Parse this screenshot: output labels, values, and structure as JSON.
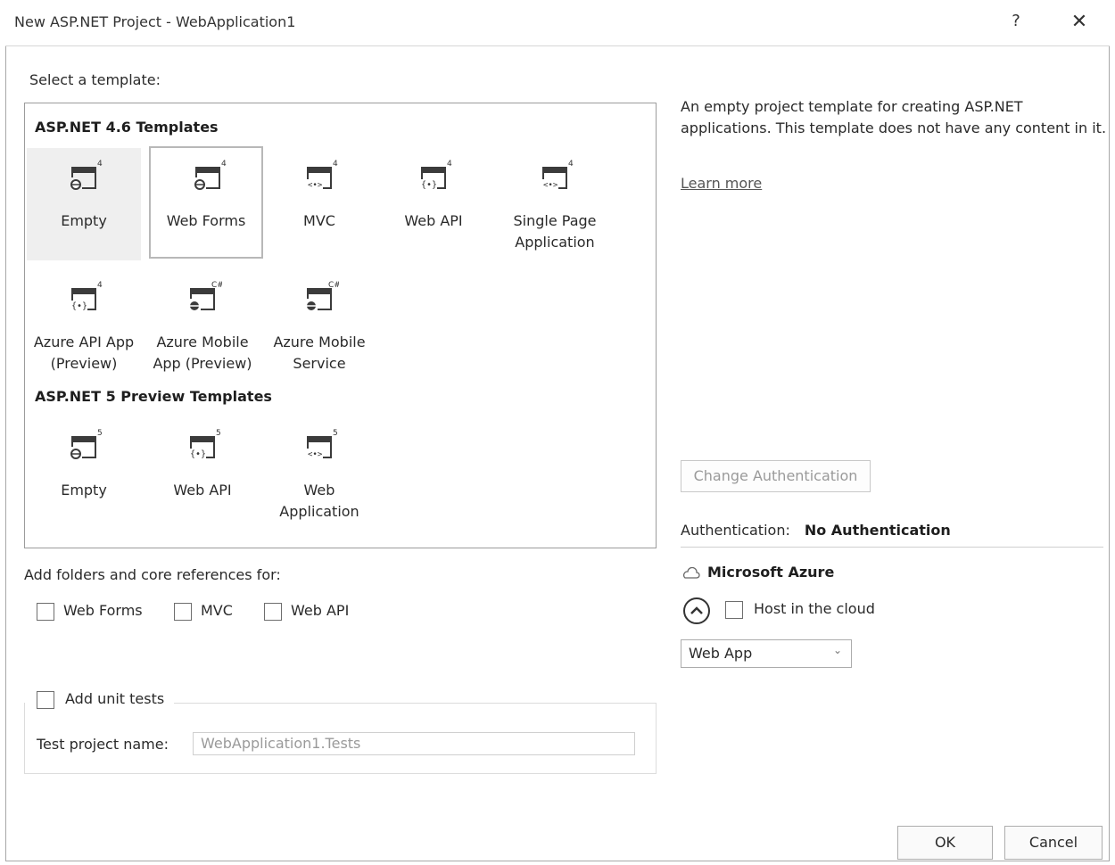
{
  "window": {
    "title": "New ASP.NET Project - WebApplication1",
    "help": "?",
    "close": "✕"
  },
  "select_template_label": "Select a template:",
  "groups": [
    {
      "heading": "ASP.NET 4.6 Templates",
      "items": [
        {
          "label": "Empty",
          "badge": "4",
          "glyph": "globe"
        },
        {
          "label": "Web Forms",
          "badge": "4",
          "glyph": "globe"
        },
        {
          "label": "MVC",
          "badge": "4",
          "glyph": "angle"
        },
        {
          "label": "Web API",
          "badge": "4",
          "glyph": "brace"
        },
        {
          "label": "Single Page\nApplication",
          "badge": "4",
          "glyph": "angle"
        },
        {
          "label": "Azure API App\n(Preview)",
          "badge": "4",
          "glyph": "brace"
        },
        {
          "label": "Azure Mobile\nApp (Preview)",
          "badge": "C#",
          "glyph": "globe"
        },
        {
          "label": "Azure Mobile\nService",
          "badge": "C#",
          "glyph": "globe"
        }
      ]
    },
    {
      "heading": "ASP.NET 5 Preview Templates",
      "items": [
        {
          "label": "Empty",
          "badge": "5",
          "glyph": "globe"
        },
        {
          "label": "Web API",
          "badge": "5",
          "glyph": "brace"
        },
        {
          "label": "Web\nApplication",
          "badge": "5",
          "glyph": "angle"
        }
      ]
    }
  ],
  "description": "An empty project template for creating ASP.NET applications. This template does not have any content in it.",
  "learn_more": "Learn more",
  "change_auth_button": "Change Authentication",
  "authentication": {
    "label": "Authentication:",
    "value": "No Authentication"
  },
  "azure": {
    "heading": "Microsoft Azure",
    "host_label": "Host in the cloud",
    "service_select": "Web App"
  },
  "add_folders_label": "Add folders and core references for:",
  "folder_options": [
    "Web Forms",
    "MVC",
    "Web API"
  ],
  "unit_tests": {
    "label": "Add unit tests",
    "project_name_label": "Test project name:",
    "project_name_value": "WebApplication1.Tests"
  },
  "footer": {
    "ok": "OK",
    "cancel": "Cancel"
  }
}
